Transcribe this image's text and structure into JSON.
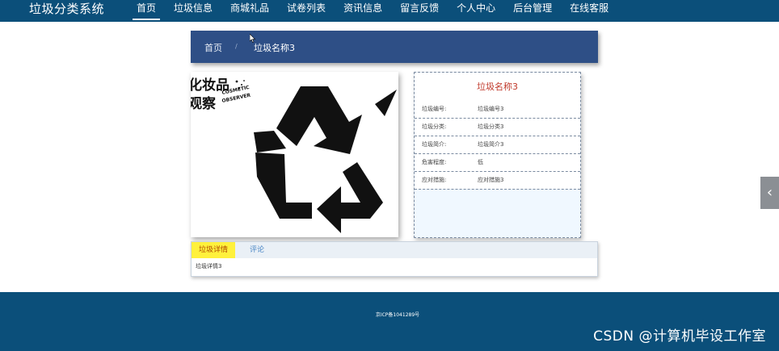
{
  "brand": "垃圾分类系统",
  "nav": [
    {
      "label": "首页",
      "active": true
    },
    {
      "label": "垃圾信息"
    },
    {
      "label": "商城礼品"
    },
    {
      "label": "试卷列表"
    },
    {
      "label": "资讯信息"
    },
    {
      "label": "留言反馈"
    },
    {
      "label": "个人中心"
    },
    {
      "label": "后台管理"
    },
    {
      "label": "在线客服"
    }
  ],
  "breadcrumb": {
    "home": "首页",
    "separator": "/",
    "current": "垃圾名称3"
  },
  "product_image": {
    "icon": "recycle-icon",
    "logo_text_cn": "化妆品观察",
    "logo_text_en_1": "COSMETIC",
    "logo_text_en_2": "OBSERVER"
  },
  "info": {
    "title": "垃圾名称3",
    "rows": [
      {
        "label": "垃圾编号:",
        "value": "垃圾编号3"
      },
      {
        "label": "垃圾分类:",
        "value": "垃圾分类3"
      },
      {
        "label": "垃圾简介:",
        "value": "垃圾简介3"
      },
      {
        "label": "危害程度:",
        "value": "低"
      },
      {
        "label": "应对措施:",
        "value": "应对措施3"
      }
    ]
  },
  "tabs": {
    "detail": "垃圾详情",
    "comment": "评论",
    "content": "垃圾详情3"
  },
  "footer": {
    "icp": "京ICP备1041289号",
    "watermark": "CSDN @计算机毕设工作室"
  },
  "side_handle_icon": "chevron-left-icon",
  "colors": {
    "nav_bg": "#0b4f7a",
    "crumb_bg": "#2e4f86",
    "title_red": "#c0392b",
    "tab_active": "#fff13c"
  }
}
